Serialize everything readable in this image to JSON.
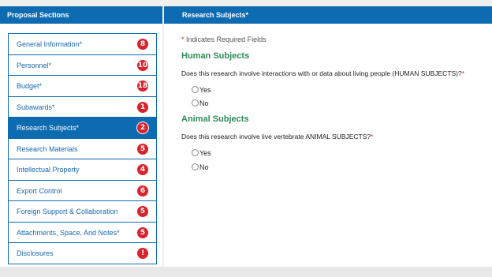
{
  "left_panel": {
    "title": "Proposal Sections",
    "items": [
      {
        "label": "General Information*",
        "badge": "8"
      },
      {
        "label": "Personnel*",
        "badge": "10"
      },
      {
        "label": "Budget*",
        "badge": "18"
      },
      {
        "label": "Subawards*",
        "badge": "1"
      },
      {
        "label": "Research Subjects*",
        "badge": "2",
        "active": true
      },
      {
        "label": "Research Materials",
        "badge": "5"
      },
      {
        "label": "Intellectual Property",
        "badge": "4"
      },
      {
        "label": "Export Control",
        "badge": "6"
      },
      {
        "label": "Foreign Support & Collaboration",
        "badge": "5"
      },
      {
        "label": "Attachments, Space, And Notes*",
        "badge": "5"
      },
      {
        "label": "Disclosures",
        "badge": "!"
      }
    ]
  },
  "main": {
    "title": "Research Subjects*",
    "required_star": "*",
    "required_note": "Indicates Required Fields",
    "human": {
      "heading": "Human Subjects",
      "question": "Does this research involve interactions with or data about living people (HUMAN SUBJECTS)?",
      "star": "*",
      "yes": "Yes",
      "no": "No"
    },
    "animal": {
      "heading": "Animal Subjects",
      "question": "Does this research involve live vertebrate ANIMAL SUBJECTS?",
      "star": "*",
      "yes": "Yes",
      "no": "No"
    }
  },
  "colors": {
    "brand_blue": "#0d6bb1",
    "badge_red": "#d9232d",
    "section_green": "#2e8b57"
  }
}
